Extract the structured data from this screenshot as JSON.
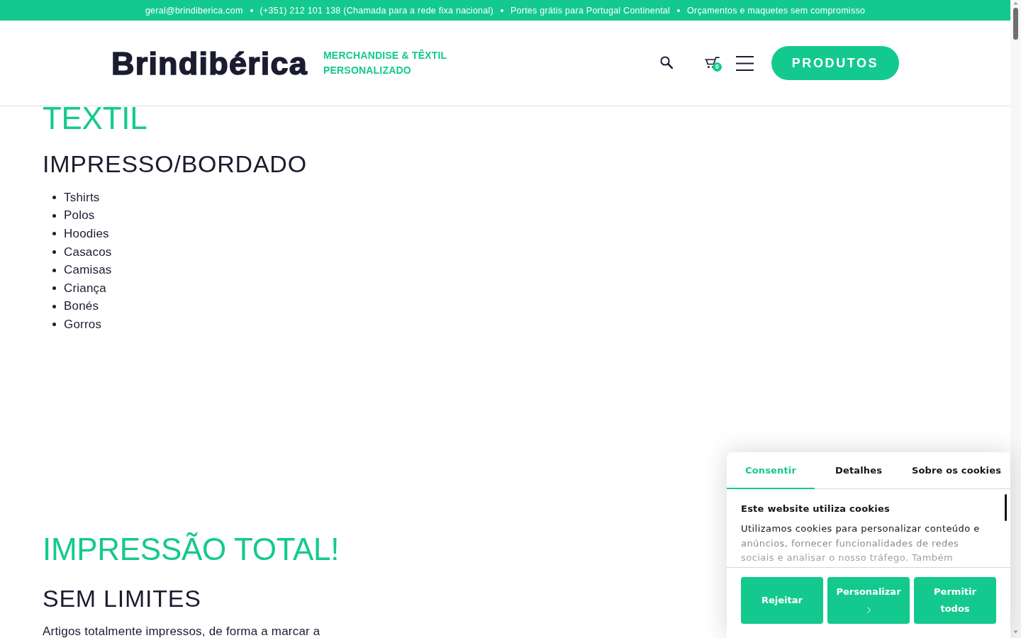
{
  "top_bar": {
    "items": [
      "geral@brindiberica.com",
      "(+351) 212 101 138 (Chamada para a rede fixa nacional)",
      "Portes grátis para Portugal Continental",
      "Orçamentos e maquetes sem compromisso"
    ]
  },
  "header": {
    "logo": "Brindibérica",
    "tagline": "MERCHANDISE & TÊXTIL PERSONALIZADO",
    "cart_count": "0",
    "button": "PRODUTOS"
  },
  "content": {
    "sections": [
      {
        "title": "TEXTIL",
        "subtitle": "IMPRESSO/BORDADO",
        "items": [
          "Tshirts",
          "Polos",
          "Hoodies",
          "Casacos",
          "Camisas",
          "Criança",
          "Bonés",
          "Gorros"
        ]
      },
      {
        "title": "IMPRESSÃO TOTAL!",
        "subtitle": "SEM LIMITES",
        "text": "Artigos totalmente impressos, de forma a marcar a"
      }
    ]
  },
  "cookie_banner": {
    "tabs": [
      {
        "label": "Consentir",
        "selected": true
      },
      {
        "label": "Detalhes",
        "selected": false
      },
      {
        "label": "Sobre os cookies",
        "selected": false
      }
    ],
    "title": "Este website utiliza cookies",
    "text": "Utilizamos cookies para personalizar conteúdo e anúncios, fornecer funcionalidades de redes sociais e analisar o nosso tráfego. Também",
    "buttons": [
      {
        "label": "Rejeitar",
        "kind": "action"
      },
      {
        "label": "Personalizar",
        "kind": "expand"
      },
      {
        "label": "Permitir todos",
        "kind": "action"
      }
    ]
  }
}
